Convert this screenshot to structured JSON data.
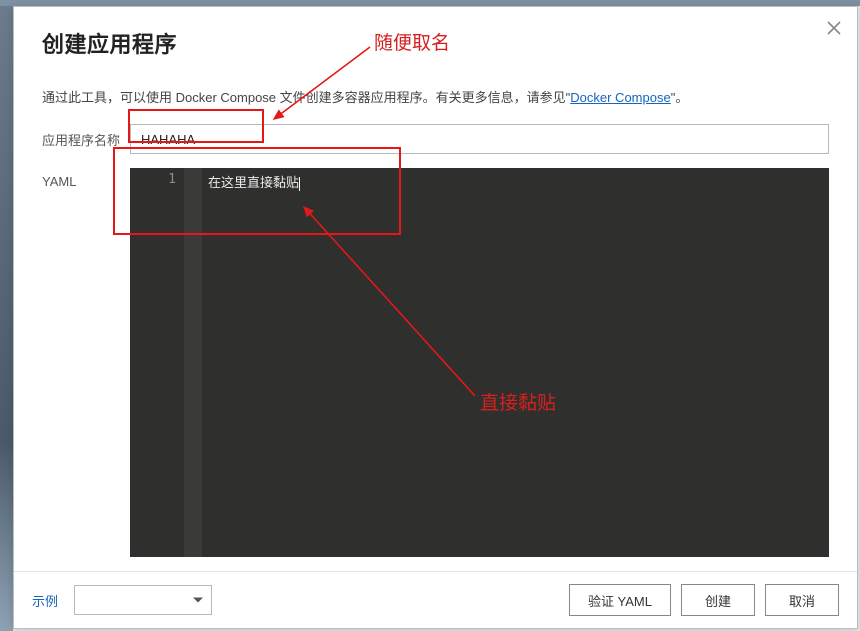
{
  "modal": {
    "title": "创建应用程序",
    "close_label": "×"
  },
  "description": {
    "text_before_link": "通过此工具，可以使用 Docker Compose 文件创建多容器应用程序。有关更多信息，请参见\"",
    "link_text": "Docker Compose",
    "text_after_link": "\"。"
  },
  "form": {
    "name_label": "应用程序名称",
    "name_value": "HAHAHA",
    "yaml_label": "YAML",
    "editor_line_number": "1",
    "editor_content": "在这里直接黏贴"
  },
  "footer": {
    "example_link": "示例",
    "select_value": "",
    "validate_btn": "验证 YAML",
    "create_btn": "创建",
    "cancel_btn": "取消"
  },
  "annotations": {
    "label1": "随便取名",
    "label2": "直接黏贴"
  }
}
